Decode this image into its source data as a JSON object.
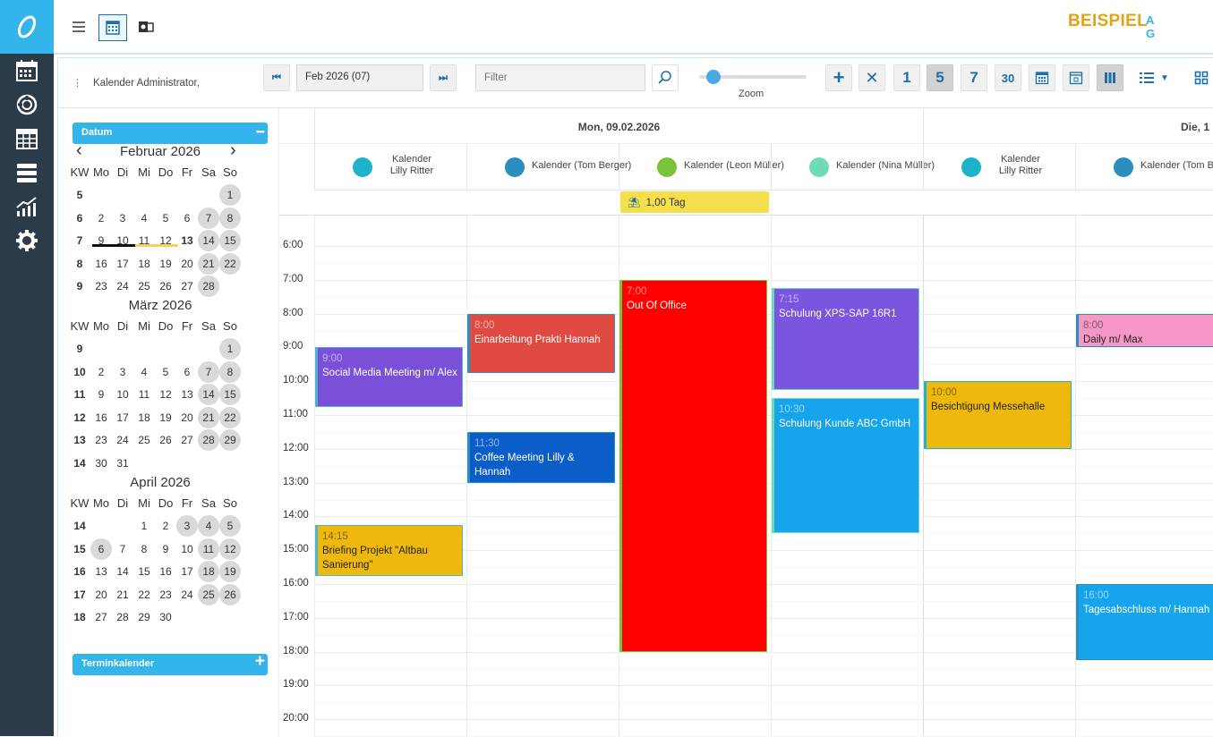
{
  "brand": {
    "name": "BEISPIEL",
    "suffix": "AG"
  },
  "toolbar": {
    "user": "Kalender Administrator,",
    "period": "Feb 2026 (07)",
    "filter_placeholder": "Filter",
    "zoom_label": "Zoom",
    "zoom_level": 0.1,
    "view_1": "1",
    "view_5": "5",
    "view_7": "7",
    "view_30": "30"
  },
  "sidebar": {
    "datum_title": "Datum",
    "termin_title": "Terminkalender",
    "weekday_headers": [
      "KW",
      "Mo",
      "Di",
      "Mi",
      "Do",
      "Fr",
      "Sa",
      "So"
    ],
    "months": [
      {
        "title": "Februar 2026",
        "weeks": [
          [
            "5",
            "",
            "",
            "",
            "",
            "",
            "",
            "1"
          ],
          [
            "6",
            "2",
            "3",
            "4",
            "5",
            "6",
            "7",
            "8"
          ],
          [
            "7",
            "9",
            "10",
            "11",
            "12",
            "13",
            "14",
            "15"
          ],
          [
            "8",
            "16",
            "17",
            "18",
            "19",
            "20",
            "21",
            "22"
          ],
          [
            "9",
            "23",
            "24",
            "25",
            "26",
            "27",
            "28",
            ""
          ]
        ]
      },
      {
        "title": "März 2026",
        "weeks": [
          [
            "9",
            "",
            "",
            "",
            "",
            "",
            "",
            "1"
          ],
          [
            "10",
            "2",
            "3",
            "4",
            "5",
            "6",
            "7",
            "8"
          ],
          [
            "11",
            "9",
            "10",
            "11",
            "12",
            "13",
            "14",
            "15"
          ],
          [
            "12",
            "16",
            "17",
            "18",
            "19",
            "20",
            "21",
            "22"
          ],
          [
            "13",
            "23",
            "24",
            "25",
            "26",
            "27",
            "28",
            "29"
          ],
          [
            "14",
            "30",
            "31",
            "",
            "",
            "",
            "",
            ""
          ]
        ]
      },
      {
        "title": "April 2026",
        "weeks": [
          [
            "14",
            "",
            "",
            "1",
            "2",
            "3",
            "4",
            "5"
          ],
          [
            "15",
            "6",
            "7",
            "8",
            "9",
            "10",
            "11",
            "12"
          ],
          [
            "16",
            "13",
            "14",
            "15",
            "16",
            "17",
            "18",
            "19"
          ],
          [
            "17",
            "20",
            "21",
            "22",
            "23",
            "24",
            "25",
            "26"
          ],
          [
            "18",
            "27",
            "28",
            "29",
            "30",
            "",
            "",
            ""
          ]
        ]
      }
    ]
  },
  "grid": {
    "days": [
      {
        "label": "Mon, 09.02.2026"
      },
      {
        "label": "Die, 1"
      }
    ],
    "calendars": [
      {
        "name": "Kalender\nLilly Ritter",
        "color": "#1fb3c9"
      },
      {
        "name": "Kalender (Tom Berger)",
        "color": "#2a8fbd"
      },
      {
        "name": "Kalender (Leon Müller)",
        "color": "#79c23a"
      },
      {
        "name": "Kalender (Nina Müller)",
        "color": "#6cdcb4"
      },
      {
        "name": "Kalender\nLilly Ritter",
        "color": "#1fb3c9"
      },
      {
        "name": "Kalender (Tom Berger",
        "color": "#2a8fbd"
      }
    ],
    "allday_event": {
      "label": "1,00 Tag",
      "color": "#f5df4d"
    },
    "hours": [
      "6:00",
      "7:00",
      "8:00",
      "9:00",
      "10:00",
      "11:00",
      "12:00",
      "13:00",
      "14:00",
      "15:00",
      "16:00",
      "17:00",
      "18:00",
      "19:00",
      "20:00"
    ],
    "events": [
      {
        "col": 0,
        "start": 9,
        "end": 10.75,
        "time": "9:00",
        "title": "Social Media Meeting m/ Alex",
        "bg": "#7b4fd8",
        "border": "#4bb5cd",
        "fg": "#ffffff"
      },
      {
        "col": 0,
        "start": 14.25,
        "end": 15.75,
        "time": "14:15",
        "title": "Briefing Projekt \"Altbau Sanierung\"",
        "bg": "#efb80c",
        "border": "#4bb5cd",
        "fg": "#222222"
      },
      {
        "col": 1,
        "start": 8,
        "end": 9.75,
        "time": "8:00",
        "title": "Einarbeitung Prakti Hannah",
        "bg": "#df4a42",
        "border": "#2a8fbd",
        "fg": "#ffffff"
      },
      {
        "col": 1,
        "start": 11.5,
        "end": 13,
        "time": "11:30",
        "title": "Coffee Meeting Lilly & Hannah",
        "bg": "#0b5ec9",
        "border": "#2a8fbd",
        "fg": "#ffffff"
      },
      {
        "col": 2,
        "start": 7,
        "end": 18,
        "time": "7:00",
        "title": "Out Of Office",
        "bg": "#ff0000",
        "border": "#79c23a",
        "fg": "#ffffff"
      },
      {
        "col": 3,
        "start": 7.25,
        "end": 10.25,
        "time": "7:15",
        "title": "Schulung XPS-SAP 16R1",
        "bg": "#7b55df",
        "border": "#6cdcb4",
        "fg": "#ffffff"
      },
      {
        "col": 3,
        "start": 10.5,
        "end": 14.5,
        "time": "10:30",
        "title": "Schulung Kunde ABC GmbH",
        "bg": "#16a5ec",
        "border": "#6cdcb4",
        "fg": "#ffffff"
      },
      {
        "col": 4,
        "start": 10,
        "end": 12,
        "time": "10:00",
        "title": "Besichtigung Messehalle",
        "bg": "#efb80c",
        "border": "#1fb3c9",
        "fg": "#222222"
      },
      {
        "col": 5,
        "start": 8,
        "end": 9,
        "time": "8:00",
        "title": "Daily m/ Max",
        "bg": "#f797c8",
        "border": "#2a8fbd",
        "fg": "#222222"
      },
      {
        "col": 5,
        "start": 16,
        "end": 18.25,
        "time": "16:00",
        "title": "Tagesabschluss m/ Hannah",
        "bg": "#16a5ec",
        "border": "#2a8fbd",
        "fg": "#ffffff"
      }
    ]
  }
}
